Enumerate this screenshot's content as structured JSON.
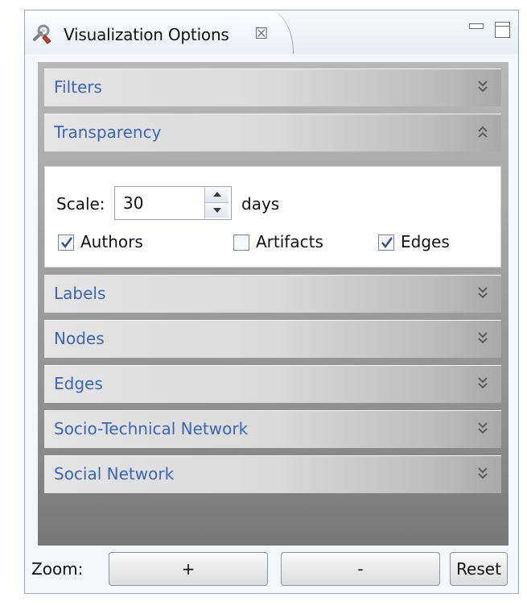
{
  "view": {
    "tab_title": "Visualization Options",
    "tab_close_glyph": "☒",
    "icons": {
      "tab_icon": "wrench-plug-icon",
      "close": "close-icon",
      "minimize": "minimize-icon",
      "maximize": "maximize-icon"
    }
  },
  "sections": [
    {
      "id": "filters",
      "label": "Filters",
      "expanded": false
    },
    {
      "id": "transparency",
      "label": "Transparency",
      "expanded": true
    },
    {
      "id": "labels",
      "label": "Labels",
      "expanded": false
    },
    {
      "id": "nodes",
      "label": "Nodes",
      "expanded": false
    },
    {
      "id": "edges",
      "label": "Edges",
      "expanded": false
    },
    {
      "id": "socio-technical-network",
      "label": "Socio-Technical Network",
      "expanded": false
    },
    {
      "id": "social-network",
      "label": "Social Network",
      "expanded": false
    }
  ],
  "transparency": {
    "scale_label": "Scale:",
    "scale_value": "30",
    "unit": "days",
    "checkboxes": [
      {
        "label": "Authors",
        "checked": true
      },
      {
        "label": "Artifacts",
        "checked": false
      },
      {
        "label": "Edges",
        "checked": true
      }
    ]
  },
  "zoom": {
    "label": "Zoom:",
    "plus_label": "+",
    "minus_label": "-",
    "reset_label": "Reset"
  },
  "colors": {
    "section_title": "#3b66b2",
    "checkmark": "#2d4e9a"
  }
}
